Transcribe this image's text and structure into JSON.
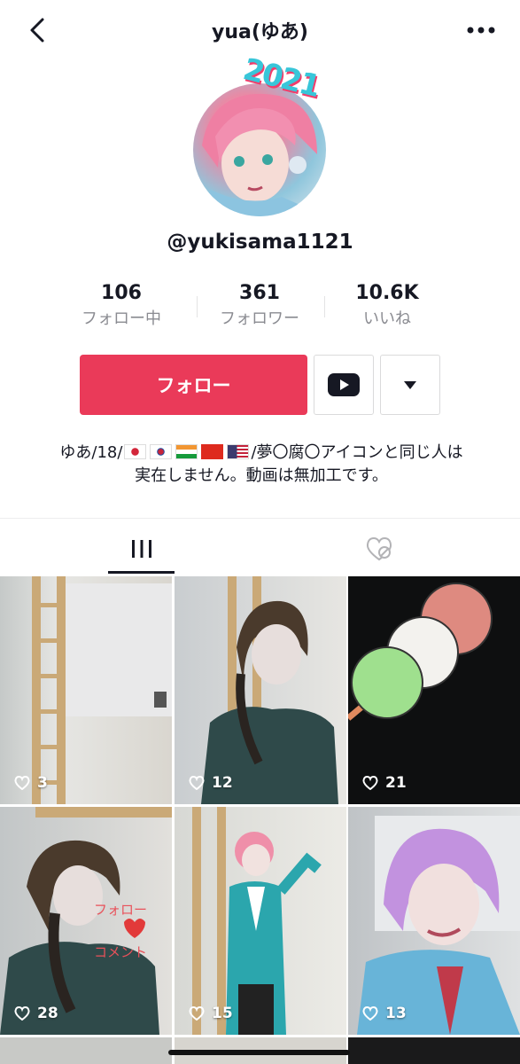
{
  "header": {
    "title": "yua(ゆあ)"
  },
  "profile": {
    "badge": "2021",
    "username": "@yukisama1121",
    "stats": [
      {
        "value": "106",
        "label": "フォロー中"
      },
      {
        "value": "361",
        "label": "フォロワー"
      },
      {
        "value": "10.6K",
        "label": "いいね"
      }
    ],
    "follow_label": "フォロー",
    "bio_prefix": "ゆあ/18/",
    "bio_flags": [
      "jp-flag",
      "kr-flag",
      "in-flag",
      "cn-flag",
      "us-flag"
    ],
    "bio_rest": "/夢〇腐〇アイコンと同じ人は実在しません。動画は無加工です。"
  },
  "videos": [
    {
      "likes": "3"
    },
    {
      "likes": "12"
    },
    {
      "likes": "21"
    },
    {
      "likes": "28"
    },
    {
      "likes": "15"
    },
    {
      "likes": "13"
    }
  ],
  "video_overlay_text": {
    "line1": "フォロー",
    "line2": "コメント"
  },
  "colors": {
    "accent": "#ea3a59",
    "text": "#161823",
    "muted": "#8a8b91"
  }
}
